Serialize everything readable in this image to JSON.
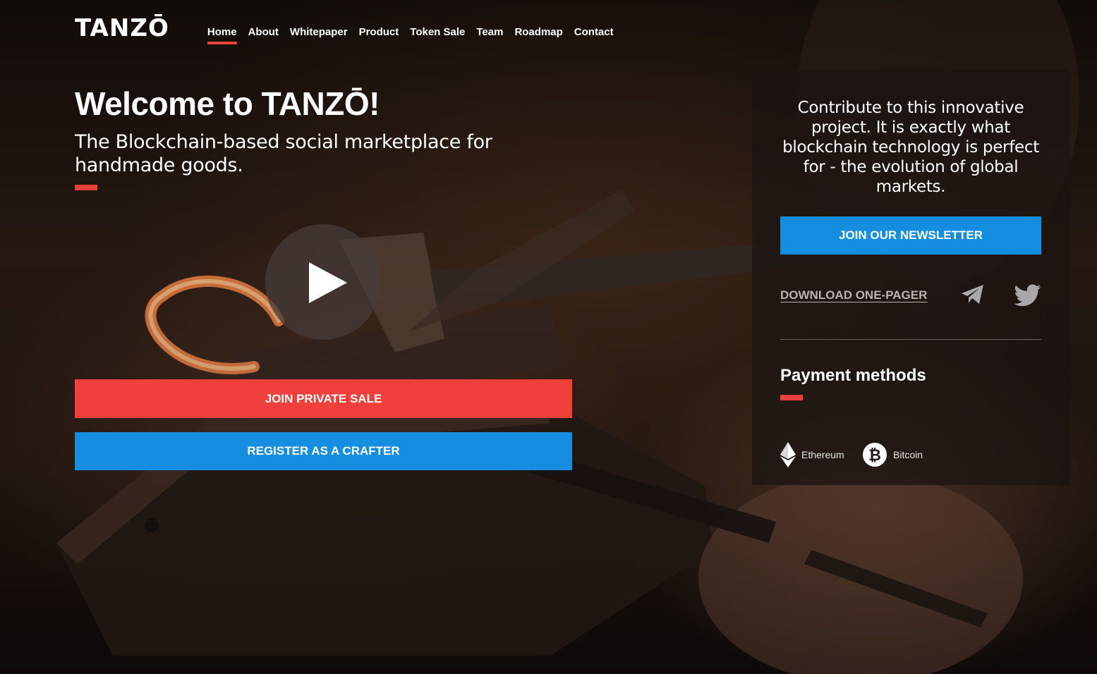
{
  "brand": {
    "logo_text": "TANZŌ"
  },
  "nav": {
    "items": [
      {
        "label": "Home",
        "active": true
      },
      {
        "label": "About"
      },
      {
        "label": "Whitepaper"
      },
      {
        "label": "Product"
      },
      {
        "label": "Token Sale"
      },
      {
        "label": "Team"
      },
      {
        "label": "Roadmap"
      },
      {
        "label": "Contact"
      }
    ]
  },
  "hero": {
    "title": "Welcome to TANZŌ!",
    "subtitle": "The Blockchain-based social marketplace for handmade goods.",
    "play_icon": "play-icon",
    "primary_button": "JOIN PRIVATE SALE",
    "secondary_button": "REGISTER AS A CRAFTER"
  },
  "panel": {
    "intro": "Contribute to this innovative project. It is exactly what blockchain technology is perfect for - the evolution of global markets.",
    "newsletter_button": "JOIN OUR NEWSLETTER",
    "download_link": "DOWNLOAD ONE-PAGER",
    "social_icons": [
      "telegram-icon",
      "twitter-icon"
    ],
    "payment_title": "Payment methods",
    "payment_methods": [
      {
        "name": "Ethereum",
        "icon": "ethereum-icon"
      },
      {
        "name": "Bitcoin",
        "icon": "bitcoin-icon"
      }
    ]
  },
  "colors": {
    "accent_red": "#ef403b",
    "accent_blue": "#168ee0",
    "muted_link": "#b9b3b2"
  }
}
